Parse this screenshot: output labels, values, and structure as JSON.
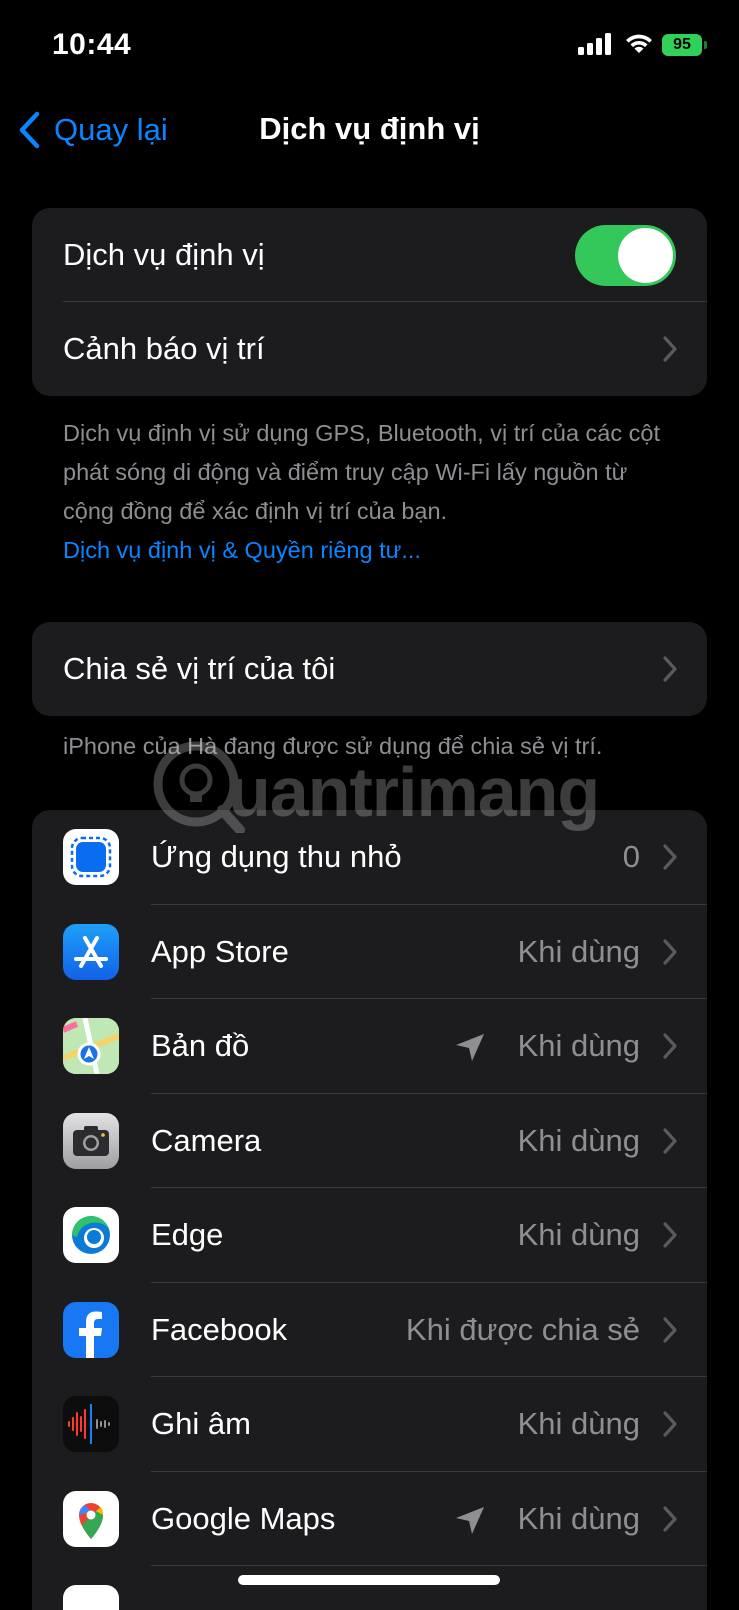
{
  "status_bar": {
    "time": "10:44",
    "battery": "95"
  },
  "nav": {
    "back_label": "Quay lại",
    "title": "Dịch vụ định vị"
  },
  "location_group": {
    "location_services_label": "Dịch vụ định vị",
    "location_services_on": true,
    "location_alerts_label": "Cảnh báo vị trí"
  },
  "footer1": {
    "text": "Dịch vụ định vị sử dụng GPS, Bluetooth, vị trí của các cột phát sóng di động và điểm truy cập Wi-Fi lấy nguồn từ cộng đồng để xác định vị trí của bạn.",
    "link": "Dịch vụ định vị & Quyền riêng tư..."
  },
  "share_group": {
    "share_label": "Chia sẻ vị trí của tôi"
  },
  "footer2": {
    "text": "iPhone của Hà đang được sử dụng để chia sẻ vị trí."
  },
  "watermark": {
    "text": "uantrimang"
  },
  "apps": [
    {
      "name": "Ứng dụng thu nhỏ",
      "value": "0",
      "icon": "widgets-icon"
    },
    {
      "name": "App Store",
      "value": "Khi dùng",
      "icon": "app-store-icon"
    },
    {
      "name": "Bản đồ",
      "value": "Khi dùng",
      "icon": "maps-icon",
      "location_arrow": true
    },
    {
      "name": "Camera",
      "value": "Khi dùng",
      "icon": "camera-icon"
    },
    {
      "name": "Edge",
      "value": "Khi dùng",
      "icon": "edge-icon"
    },
    {
      "name": "Facebook",
      "value": "Khi được chia sẻ",
      "icon": "facebook-icon"
    },
    {
      "name": "Ghi âm",
      "value": "Khi dùng",
      "icon": "voice-memos-icon"
    },
    {
      "name": "Google Maps",
      "value": "Khi dùng",
      "icon": "google-maps-icon",
      "location_arrow": true
    }
  ],
  "colors": {
    "accent": "#0a84ff",
    "toggle_on": "#34c759",
    "cell_bg": "#1c1c1e",
    "secondary_text": "#8e8e93"
  }
}
